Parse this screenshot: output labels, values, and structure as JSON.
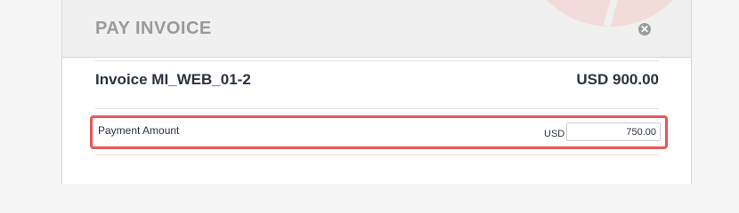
{
  "modal": {
    "title": "PAY INVOICE",
    "close_glyph": "✕"
  },
  "invoice": {
    "name": "Invoice MI_WEB_01-2",
    "total": "USD 900.00"
  },
  "payment": {
    "label": "Payment Amount",
    "currency": "USD",
    "amount_value": "750.00"
  },
  "colors": {
    "highlight_border": "#e9575a",
    "title_gray": "#9a9a9a",
    "text_dark": "#2a3340"
  }
}
